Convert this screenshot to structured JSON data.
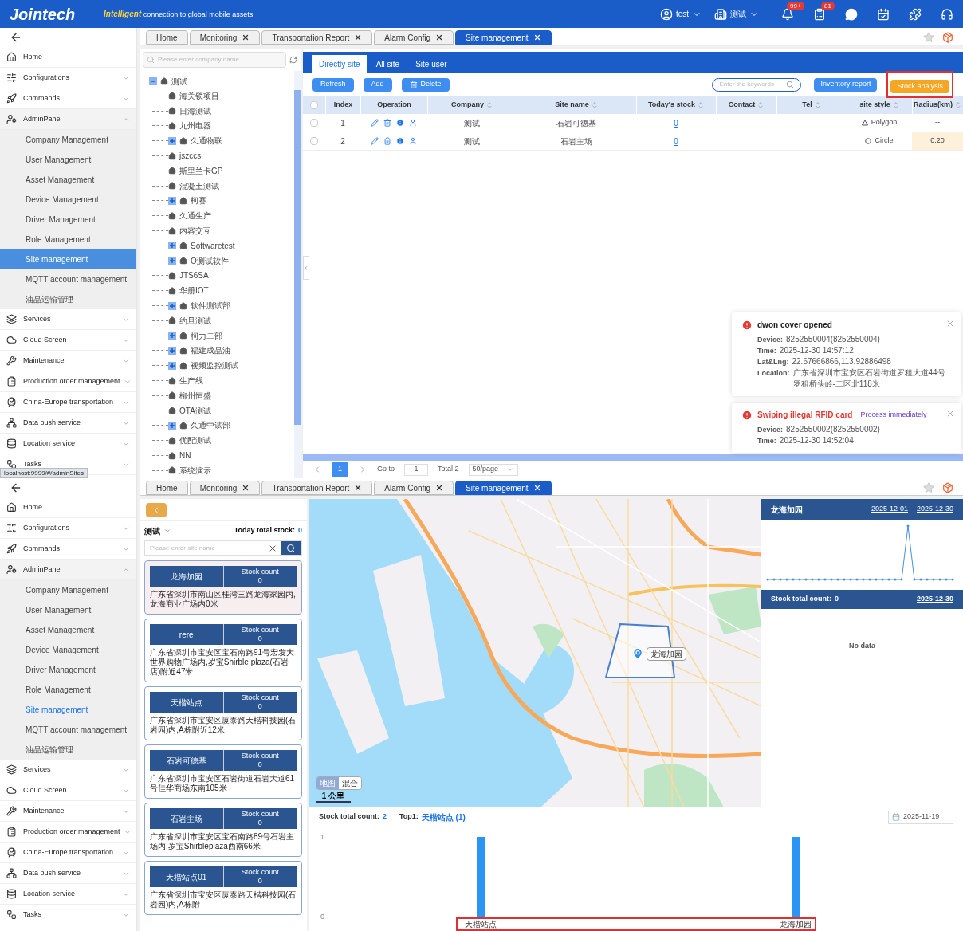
{
  "top_screen": {
    "header": {
      "logo": "Jointech",
      "tagline_highlight": "Intelligent",
      "tagline": "connection to global mobile assets",
      "user": "test",
      "org": "测试",
      "alerts_badge": "99+",
      "tasks_badge": "81"
    },
    "sidebar": {
      "items": [
        {
          "label": "Home",
          "kind": "link"
        },
        {
          "label": "Configurations",
          "kind": "group",
          "expanded": false
        },
        {
          "label": "Commands",
          "kind": "group",
          "expanded": false
        },
        {
          "label": "AdminPanel",
          "kind": "group",
          "expanded": true,
          "children": [
            {
              "label": "Company Management",
              "selected": false
            },
            {
              "label": "User Management",
              "selected": false
            },
            {
              "label": "Asset Management",
              "selected": false
            },
            {
              "label": "Device Management",
              "selected": false
            },
            {
              "label": "Driver Management",
              "selected": false
            },
            {
              "label": "Role Management",
              "selected": false
            },
            {
              "label": "Site management",
              "selected": true
            },
            {
              "label": "MQTT account management",
              "selected": false
            },
            {
              "label": "油品运输管理",
              "selected": false
            }
          ]
        },
        {
          "label": "Services",
          "kind": "group",
          "expanded": false
        },
        {
          "label": "Cloud Screen",
          "kind": "group",
          "expanded": false
        },
        {
          "label": "Maintenance",
          "kind": "group",
          "expanded": false
        },
        {
          "label": "Production order management",
          "kind": "group",
          "expanded": false
        },
        {
          "label": "China-Europe transportation",
          "kind": "group",
          "expanded": false
        },
        {
          "label": "Data push service",
          "kind": "group",
          "expanded": false
        },
        {
          "label": "Location service",
          "kind": "group",
          "expanded": false
        },
        {
          "label": "Tasks",
          "kind": "group",
          "expanded": false
        }
      ]
    },
    "tabs": [
      {
        "label": "Home",
        "closable": false,
        "selected": false
      },
      {
        "label": "Monitoring",
        "closable": true,
        "selected": false
      },
      {
        "label": "Transportation Report",
        "closable": true,
        "selected": false
      },
      {
        "label": "Alarm Config",
        "closable": true,
        "selected": false
      },
      {
        "label": "Site management",
        "closable": true,
        "selected": true
      }
    ],
    "tree": {
      "placeholder": "Please enter company name",
      "root": {
        "label": "测试",
        "expanded": true,
        "children": [
          {
            "label": "海关锁项目",
            "kind": "leaf"
          },
          {
            "label": "日海测试",
            "kind": "leaf"
          },
          {
            "label": "九州电器",
            "kind": "leaf"
          },
          {
            "label": "久通物联",
            "kind": "folder"
          },
          {
            "label": "jszccs",
            "kind": "leaf"
          },
          {
            "label": "斯里兰卡GP",
            "kind": "leaf"
          },
          {
            "label": "混凝土测试",
            "kind": "leaf"
          },
          {
            "label": "柯赛",
            "kind": "folder"
          },
          {
            "label": "久通生产",
            "kind": "leaf"
          },
          {
            "label": "内容交互",
            "kind": "leaf"
          },
          {
            "label": "Softwaretest",
            "kind": "folder"
          },
          {
            "label": "O测试软件",
            "kind": "folder"
          },
          {
            "label": "JTS6SA",
            "kind": "leaf"
          },
          {
            "label": "华册IOT",
            "kind": "leaf"
          },
          {
            "label": "软件测试部",
            "kind": "folder"
          },
          {
            "label": "约旦测试",
            "kind": "leaf"
          },
          {
            "label": "柯力二部",
            "kind": "folder"
          },
          {
            "label": "福建成品油",
            "kind": "folder"
          },
          {
            "label": "视频监控测试",
            "kind": "folder"
          },
          {
            "label": "生产线",
            "kind": "leaf"
          },
          {
            "label": "柳州恒盛",
            "kind": "leaf"
          },
          {
            "label": "OTA测试",
            "kind": "leaf"
          },
          {
            "label": "久通中试部",
            "kind": "folder"
          },
          {
            "label": "优配测试",
            "kind": "leaf"
          },
          {
            "label": "NN",
            "kind": "leaf"
          },
          {
            "label": "系统演示",
            "kind": "leaf"
          }
        ]
      }
    },
    "content": {
      "subtabs": [
        {
          "label": "Directly site",
          "selected": true
        },
        {
          "label": "All site",
          "selected": false
        },
        {
          "label": "Site user",
          "selected": false
        }
      ],
      "buttons": [
        {
          "label": "Refresh",
          "kind": "plain"
        },
        {
          "label": "Add",
          "kind": "plain"
        },
        {
          "label": "Delete",
          "kind": "delete"
        }
      ],
      "search_placeholder": "Enter the keywords",
      "inventory_button": "Inventory report",
      "stock_button": "Stock analysis",
      "columns": [
        {
          "label": "Index",
          "sortable": false
        },
        {
          "label": "Operation",
          "sortable": false
        },
        {
          "label": "Company",
          "sortable": true
        },
        {
          "label": "Site name",
          "sortable": true
        },
        {
          "label": "Today's stock",
          "sortable": true
        },
        {
          "label": "Contact",
          "sortable": true
        },
        {
          "label": "Tel",
          "sortable": true
        },
        {
          "label": "site style",
          "sortable": true
        },
        {
          "label": "Radius(km)",
          "sortable": true
        }
      ],
      "rows": [
        {
          "checked": false,
          "index": "1",
          "company": "测试",
          "site_name": "石岩可德基",
          "stock": "0",
          "style": "Polygon",
          "kind": "polygon",
          "radius": "--"
        },
        {
          "checked": false,
          "index": "2",
          "company": "测试",
          "site_name": "石岩主场",
          "stock": "0",
          "style": "Circle",
          "kind": "circle",
          "radius": "0.20"
        }
      ],
      "select_all_checked": false,
      "pagination": {
        "page": "1",
        "goto": "Go to",
        "goto_value": "1",
        "total": "Total 2",
        "page_size": "50/page"
      }
    },
    "notifications": [
      {
        "kind": "info",
        "title": "dwon cover opened",
        "lines": [
          {
            "label": "Device:",
            "value": "8252550004(8252550004)"
          },
          {
            "label": "Time:",
            "value": "2025-12-30 14:57:12"
          },
          {
            "label": "Lat&Lng:",
            "value": "22.67666866,113.92886498"
          },
          {
            "label": "Location:",
            "value": "广东省深圳市宝安区石岩街道罗租大道44号罗租桥头岭-二区北118米"
          }
        ]
      },
      {
        "kind": "alarm",
        "title": "Swiping illegal RFID card",
        "link": "Process immediately",
        "lines": [
          {
            "label": "Device:",
            "value": "8252550002(8252550002)"
          },
          {
            "label": "Time:",
            "value": "2025-12-30 14:52:04"
          }
        ]
      }
    ],
    "status_url": "localhost:9999/#/adminSites"
  },
  "bottom_screen": {
    "sidebar": {
      "items": [
        {
          "label": "Home",
          "kind": "link"
        },
        {
          "label": "Configurations",
          "kind": "group",
          "expanded": false
        },
        {
          "label": "Commands",
          "kind": "group",
          "expanded": false
        },
        {
          "label": "AdminPanel",
          "kind": "group",
          "expanded": true,
          "children": [
            {
              "label": "Company Management",
              "selected": false
            },
            {
              "label": "User Management",
              "selected": false
            },
            {
              "label": "Asset Management",
              "selected": false
            },
            {
              "label": "Device Management",
              "selected": false
            },
            {
              "label": "Driver Management",
              "selected": false
            },
            {
              "label": "Role Management",
              "selected": false
            },
            {
              "label": "Site management",
              "selected": true
            },
            {
              "label": "MQTT account management",
              "selected": false
            },
            {
              "label": "油品运输管理",
              "selected": false
            }
          ]
        },
        {
          "label": "Services",
          "kind": "group",
          "expanded": false
        },
        {
          "label": "Cloud Screen",
          "kind": "group",
          "expanded": false
        },
        {
          "label": "Maintenance",
          "kind": "group",
          "expanded": false
        },
        {
          "label": "Production order management",
          "kind": "group",
          "expanded": false
        },
        {
          "label": "China-Europe transportation",
          "kind": "group",
          "expanded": false
        },
        {
          "label": "Data push service",
          "kind": "group",
          "expanded": false
        },
        {
          "label": "Location service",
          "kind": "group",
          "expanded": false
        },
        {
          "label": "Tasks",
          "kind": "group",
          "expanded": false
        }
      ]
    },
    "tabs": [
      {
        "label": "Home",
        "closable": false,
        "selected": false
      },
      {
        "label": "Monitoring",
        "closable": true,
        "selected": false
      },
      {
        "label": "Transportation Report",
        "closable": true,
        "selected": false
      },
      {
        "label": "Alarm Config",
        "closable": true,
        "selected": false
      },
      {
        "label": "Site management",
        "closable": true,
        "selected": true
      }
    ],
    "site_list": {
      "company": "测试",
      "total_label": "Today total stock:",
      "total": "0",
      "placeholder": "Please enter site name",
      "cards": [
        {
          "name": "龙海加园",
          "stock_label": "Stock count",
          "stock": "0",
          "address": "广东省深圳市南山区桂湾三路龙海家园内,龙海商业广场内0米",
          "selected": true
        },
        {
          "name": "rere",
          "stock_label": "Stock count",
          "stock": "0",
          "address": "广东省深圳市宝安区宝石南路91号宏发大世界购物广场内,岁宝Shirble plaza(石岩店)附近47米",
          "selected": false
        },
        {
          "name": "天楷站点",
          "stock_label": "Stock count",
          "stock": "0",
          "address": "广东省深圳市宝安区厦泰路天楷科技园(石岩园)内,A栋附近12米",
          "selected": false
        },
        {
          "name": "石岩可德基",
          "stock_label": "Stock count",
          "stock": "0",
          "address": "广东省深圳市宝安区石岩街道石岩大道61号佳华商场东南105米",
          "selected": false
        },
        {
          "name": "石岩主场",
          "stock_label": "Stock count",
          "stock": "0",
          "address": "广东省深圳市宝安区宝石南路89号石岩主场内,岁宝Shirbleplaza西南66米",
          "selected": false
        },
        {
          "name": "天楷站点01",
          "stock_label": "Stock count",
          "stock": "0",
          "address": "广东省深圳市宝安区厦泰路天楷科技园(石岩园)内,A栋附",
          "selected": false
        }
      ]
    },
    "map": {
      "marker_label": "龙海加园",
      "map_types": [
        {
          "label": "地图",
          "selected": true
        },
        {
          "label": "混合",
          "selected": false
        }
      ],
      "scale": "1 公里"
    },
    "site_panel": {
      "title": "龙海加园",
      "date_from": "2025-12-01",
      "date_sep": "-",
      "date_to": "2025-12-30",
      "count_label": "Stock total count:",
      "count": "0",
      "count_date": "2025-12-30",
      "empty": "No data"
    },
    "summary": {
      "count_label": "Stock total count:",
      "count": "2",
      "top_label": "Top1:",
      "top_value": "天楷站点 (1)",
      "date": "2025-11-19"
    },
    "chart_data": {
      "type": "bar",
      "categories": [
        "天楷站点",
        "龙海加园"
      ],
      "values": [
        1,
        1
      ],
      "yticks": [
        0,
        1
      ],
      "ylim": [
        0,
        1
      ]
    }
  }
}
